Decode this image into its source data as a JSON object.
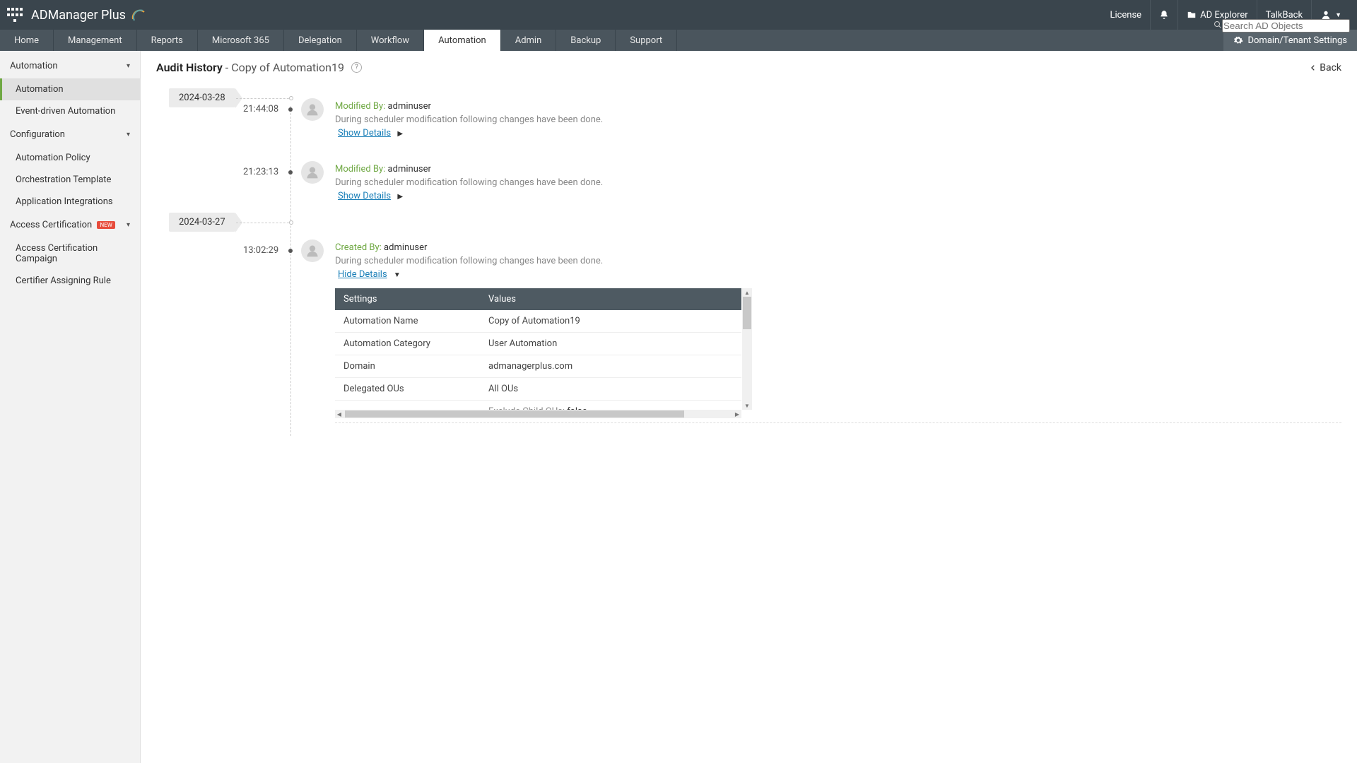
{
  "topbar": {
    "product": "ADManager Plus",
    "license": "License",
    "ad_explorer": "AD Explorer",
    "talkback": "TalkBack",
    "search_placeholder": "Search AD Objects"
  },
  "tabs": [
    {
      "label": "Home"
    },
    {
      "label": "Management"
    },
    {
      "label": "Reports"
    },
    {
      "label": "Microsoft 365"
    },
    {
      "label": "Delegation"
    },
    {
      "label": "Workflow"
    },
    {
      "label": "Automation",
      "active": true
    },
    {
      "label": "Admin"
    },
    {
      "label": "Backup"
    },
    {
      "label": "Support"
    }
  ],
  "domain_btn": "Domain/Tenant Settings",
  "sidebar": {
    "sections": [
      {
        "title": "Automation",
        "items": [
          {
            "label": "Automation",
            "active": true
          },
          {
            "label": "Event-driven Automation"
          }
        ]
      },
      {
        "title": "Configuration",
        "items": [
          {
            "label": "Automation Policy"
          },
          {
            "label": "Orchestration Template"
          },
          {
            "label": "Application Integrations"
          }
        ]
      },
      {
        "title": "Access Certification",
        "badge": "NEW",
        "items": [
          {
            "label": "Access Certification Campaign"
          },
          {
            "label": "Certifier Assigning Rule"
          }
        ]
      }
    ]
  },
  "page": {
    "title": "Audit History",
    "sub": " - Copy of Automation19",
    "back": "Back"
  },
  "timeline": [
    {
      "date": "2024-03-28",
      "entries": [
        {
          "time": "21:44:08",
          "action_label": "Modified By:",
          "user": "adminuser",
          "desc": "During scheduler modification following changes have been done.",
          "details_link": "Show Details",
          "expanded": false
        },
        {
          "time": "21:23:13",
          "action_label": "Modified By:",
          "user": "adminuser",
          "desc": "During scheduler modification following changes have been done.",
          "details_link": "Show Details",
          "expanded": false
        }
      ]
    },
    {
      "date": "2024-03-27",
      "entries": [
        {
          "time": "13:02:29",
          "action_label": "Created By:",
          "user": "adminuser",
          "desc": "During scheduler modification following changes have been done.",
          "details_link": "Hide Details",
          "expanded": true,
          "table": {
            "headers": [
              "Settings",
              "Values"
            ],
            "rows": [
              {
                "setting": "Automation Name",
                "value": "Copy of Automation19"
              },
              {
                "setting": "Automation Category",
                "value": "User Automation"
              },
              {
                "setting": "Domain",
                "value": "admanagerplus.com"
              },
              {
                "setting": "Delegated OUs",
                "value": "All OUs"
              }
            ],
            "extra": {
              "label": "Exclude Child OUs:",
              "value": "false"
            }
          }
        }
      ]
    }
  ]
}
